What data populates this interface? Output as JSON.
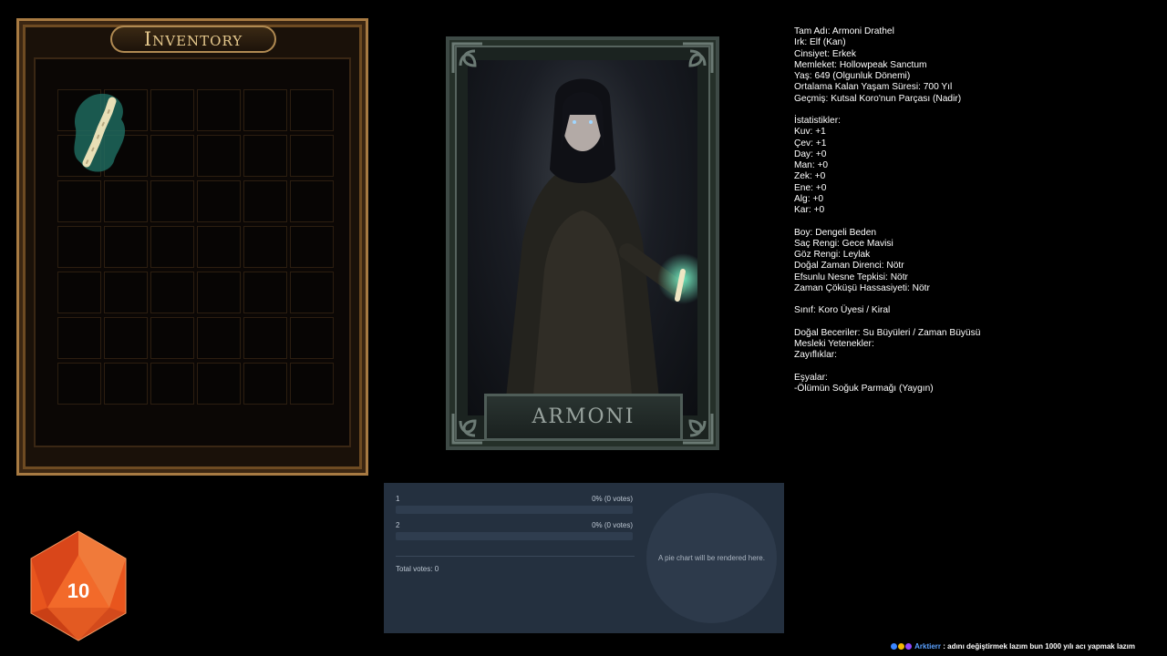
{
  "inventory": {
    "title": "Inventory",
    "rows": 7,
    "cols": 6,
    "items": [
      {
        "name": "Ölümün Soğuk Parmağı",
        "icon": "bone-finger-icon",
        "slot_row": 1,
        "slot_col": 1
      }
    ]
  },
  "portrait": {
    "name": "ARMONI"
  },
  "character": {
    "info": [
      "Tam Adı: Armoni Drathel",
      "Irk: Elf (Kan)",
      "Cinsiyet: Erkek",
      "Memleket: Hollowpeak Sanctum",
      "Yaş: 649 (Olgunluk Dönemi)",
      "Ortalama Kalan Yaşam Süresi: 700 Yıl",
      "Geçmiş: Kutsal Koro'nun Parçası (Nadir)"
    ],
    "stats_header": "İstatistikler:",
    "stats": [
      "Kuv: +1",
      "Çev: +1",
      "Day: +0",
      "Man: +0",
      "Zek: +0",
      "Ene: +0",
      "Alg: +0",
      "Kar: +0"
    ],
    "traits": [
      "Boy: Dengeli Beden",
      "Saç Rengi: Gece Mavisi",
      "Göz Rengi: Leylak",
      "Doğal Zaman Direnci: Nötr",
      "Efsunlu Nesne Tepkisi: Nötr",
      "Zaman Çöküşü Hassasiyeti: Nötr"
    ],
    "class": "Sınıf: Koro Üyesi / Kiral",
    "skills": [
      "Doğal Beceriler: Su Büyüleri / Zaman Büyüsü",
      "Mesleki Yetenekler:",
      "Zayıflıklar:"
    ],
    "items_header": "Eşyalar:",
    "items": [
      "-Ölümün Soğuk Parmağı (Yaygın)"
    ]
  },
  "poll": {
    "options": [
      {
        "label": "1",
        "result": "0% (0 votes)",
        "fraction": 0
      },
      {
        "label": "2",
        "result": "0% (0 votes)",
        "fraction": 0
      }
    ],
    "total": "Total votes: 0",
    "pie_placeholder": "A pie chart will be rendered here."
  },
  "dice": {
    "value": "10",
    "color": "#e8551d"
  },
  "chat": {
    "user": "Arktierr",
    "separator": " : ",
    "message": "adını değiştirmek lazım bun 1000 yılı acı yapmak lazım"
  }
}
